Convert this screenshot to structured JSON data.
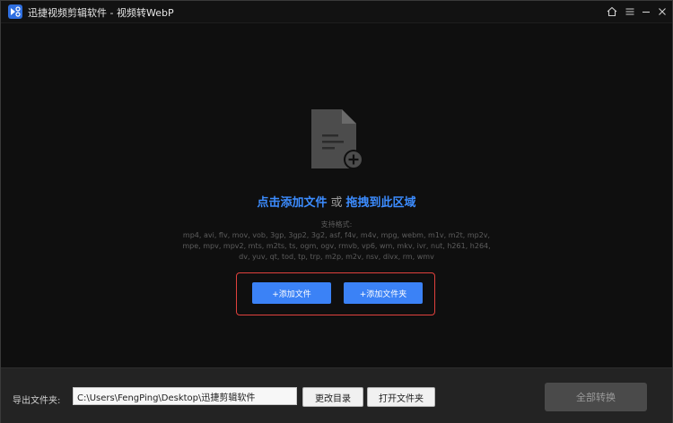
{
  "titlebar": {
    "title": "迅捷视频剪辑软件 - 视频转WebP"
  },
  "dropzone": {
    "add_file_link": "点击添加文件",
    "or_text": "或",
    "drag_text": "拖拽到此区域",
    "formats_title": "支持格式:",
    "formats_line1": "mp4, avi, flv, mov, vob, 3gp, 3gp2, 3g2, asf, f4v, m4v, mpg, webm, m1v, m2t, mp2v,",
    "formats_line2": "mpe, mpv, mpv2, mts, m2ts, ts, ogm, ogv, rmvb, vp6, wm, mkv, ivr, nut, h261, h264,",
    "formats_line3": "dv, yuv, qt, tod, tp, trp, m2p, m2v, nsv, divx, rm, wmv",
    "add_file_button": "+添加文件",
    "add_folder_button": "+添加文件夹"
  },
  "bottombar": {
    "export_label": "导出文件夹:",
    "export_path": "C:\\Users\\FengPing\\Desktop\\迅捷剪辑软件",
    "change_dir_button": "更改目录",
    "open_folder_button": "打开文件夹",
    "convert_all_button": "全部转换"
  },
  "colors": {
    "accent_blue": "#3b82f6",
    "link_blue": "#3c8cff",
    "highlight_red": "#e0413d",
    "background": "#0f0f0f"
  },
  "icons": {
    "logo": "app-logo-icon",
    "home": "home-icon",
    "menu": "menu-icon",
    "minimize": "minimize-icon",
    "close": "close-icon",
    "document": "document-add-icon"
  }
}
